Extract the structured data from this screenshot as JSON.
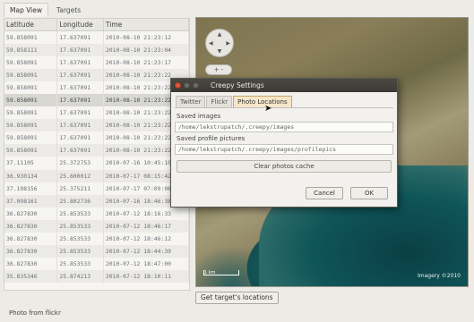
{
  "tabs": [
    "Map View",
    "Targets"
  ],
  "table": {
    "headers": [
      "Latitude",
      "Longitude",
      "Time"
    ],
    "rows": [
      [
        "59.858091",
        "17.637091",
        "2010-08-10 21:23:12"
      ],
      [
        "59.858111",
        "17.637091",
        "2010-08-10 21:23:04"
      ],
      [
        "59.858091",
        "17.637091",
        "2010-08-10 21:23:17"
      ],
      [
        "59.858091",
        "17.637091",
        "2010-08-10 21:23:22"
      ],
      [
        "59.858091",
        "17.637091",
        "2010-08-10 21:23:22"
      ],
      [
        "59.858091",
        "17.637091",
        "2010-08-10 21:23:22"
      ],
      [
        "59.858091",
        "17.637091",
        "2010-08-10 21:23:22"
      ],
      [
        "59.858091",
        "17.637091",
        "2010-08-10 21:23:22"
      ],
      [
        "59.858091",
        "17.637091",
        "2010-08-10 21:23:22"
      ],
      [
        "59.858091",
        "17.637091",
        "2010-08-10 21:23:22"
      ],
      [
        "37.11105",
        "25.372753",
        "2010-07-16 10:45:10"
      ],
      [
        "36.930134",
        "25.600012",
        "2010-07-17 08:15:42"
      ],
      [
        "37.108156",
        "25.375211",
        "2010-07-17 07:09:08"
      ],
      [
        "37.098161",
        "25.802736",
        "2010-07-16 18:46:38"
      ],
      [
        "36.827830",
        "25.853533",
        "2010-07-12 18:16:33"
      ],
      [
        "36.827830",
        "25.853533",
        "2010-07-12 18:46:17"
      ],
      [
        "36.827830",
        "25.853533",
        "2010-07-12 18:46:12"
      ],
      [
        "36.827830",
        "25.853533",
        "2010-07-12 18:44:39"
      ],
      [
        "36.827830",
        "25.853533",
        "2010-07-12 18:47:00"
      ],
      [
        "35.835346",
        "25.874213",
        "2010-07-12 18:10:11"
      ]
    ],
    "selected_row": 5
  },
  "map": {
    "zoom_label": "+ -",
    "scale_label": "1 km",
    "attribution": "Imagery ©2010"
  },
  "locate_button": "Get target's locations",
  "bottom_label": "Photo from flickr",
  "dialog": {
    "title": "Creepy Settings",
    "tabs": [
      "Twitter",
      "Flickr",
      "Photo Locations"
    ],
    "active_tab": 2,
    "saved_images_label": "Saved images",
    "saved_images_value": "/home/lekstrupatch/.creepy/images",
    "saved_profile_label": "Saved profile pictures",
    "saved_profile_value": "/home/lekstrupatch/.creepy/images/profilepics",
    "clear_button": "Clear photos cache",
    "cancel_button": "Cancel",
    "ok_button": "OK"
  },
  "colors": {
    "accent_tab": "#f6e6c9",
    "close_button": "#e0563a"
  }
}
